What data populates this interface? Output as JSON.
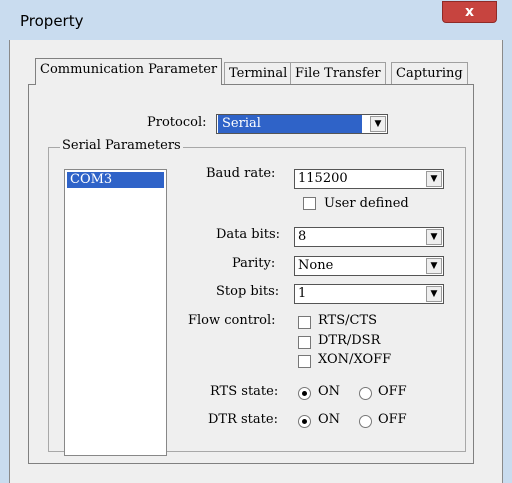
{
  "window": {
    "title": "Property",
    "close_glyph": "x"
  },
  "tabs": [
    {
      "label": "Communication Parameter"
    },
    {
      "label": "Terminal"
    },
    {
      "label": "File Transfer"
    },
    {
      "label": "Capturing"
    }
  ],
  "protocol": {
    "label": "Protocol:",
    "value": "Serial"
  },
  "serial": {
    "group_label": "Serial Parameters",
    "ports": [
      "COM3"
    ],
    "baud": {
      "label": "Baud rate:",
      "value": "115200"
    },
    "user_defined": {
      "label": "User defined",
      "checked": false
    },
    "data_bits": {
      "label": "Data bits:",
      "value": "8"
    },
    "parity": {
      "label": "Parity:",
      "value": "None"
    },
    "stop_bits": {
      "label": "Stop bits:",
      "value": "1"
    },
    "flow_control": {
      "label": "Flow control:",
      "options": [
        "RTS/CTS",
        "DTR/DSR",
        "XON/XOFF"
      ]
    },
    "rts_state": {
      "label": "RTS state:",
      "on": "ON",
      "off": "OFF",
      "selected": "ON"
    },
    "dtr_state": {
      "label": "DTR state:",
      "on": "ON",
      "off": "OFF",
      "selected": "ON"
    }
  },
  "colors": {
    "title_bar": "#c9dcef",
    "close_button": "#c7443f",
    "selection": "#2f63c8",
    "dialog_face": "#efefef"
  },
  "icons": {
    "dropdown": "chevron-down-icon",
    "close": "close-icon"
  }
}
